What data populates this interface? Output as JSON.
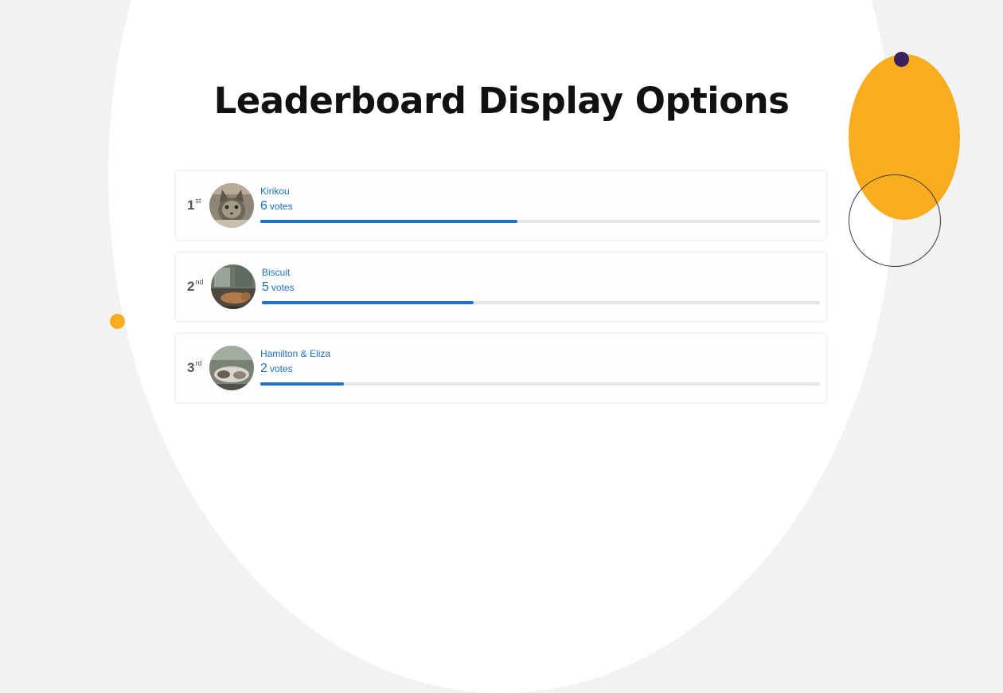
{
  "title": "Leaderboard Display Options",
  "colors": {
    "accent": "#1c72c6",
    "bar_fill": "#1e73c8",
    "decor_yellow": "#f7ad1f",
    "decor_purple": "#3b2160",
    "background": "#f1f2f2"
  },
  "leaderboard": {
    "entries": [
      {
        "rank": "1",
        "rank_suffix": "st",
        "name": "Kirikou",
        "votes": "6",
        "votes_label": "votes",
        "progress_pct": 46,
        "avatar_icon": "cat-photo"
      },
      {
        "rank": "2",
        "rank_suffix": "nd",
        "name": "Biscuit",
        "votes": "5",
        "votes_label": "votes",
        "progress_pct": 38,
        "avatar_icon": "dog-photo"
      },
      {
        "rank": "3",
        "rank_suffix": "rd",
        "name": "Hamilton & Eliza",
        "votes": "2",
        "votes_label": "votes",
        "progress_pct": 15,
        "avatar_icon": "pets-photo"
      }
    ]
  }
}
